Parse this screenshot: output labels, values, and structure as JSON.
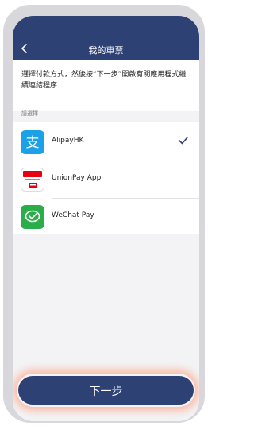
{
  "header": {
    "title": "我的車票"
  },
  "description": "選擇付款方式，然後按“下一步”開啟有關應用程式繼續連結程序",
  "section_label": "請選擇",
  "payment_methods": [
    {
      "name": "AlipayHK",
      "icon": "alipay-icon",
      "selected": true
    },
    {
      "name": "UnionPay App",
      "icon": "unionpay-icon",
      "selected": false
    },
    {
      "name": "WeChat Pay",
      "icon": "wechat-pay-icon",
      "selected": false
    }
  ],
  "next_button": "下一步",
  "colors": {
    "header": "#2e4175",
    "button": "#2e4175",
    "button_glow": "#ff9673",
    "check": "#2e4175",
    "alipay": "#1ca0e8",
    "unionpay": "#e60012",
    "wechat": "#2bae4a"
  }
}
